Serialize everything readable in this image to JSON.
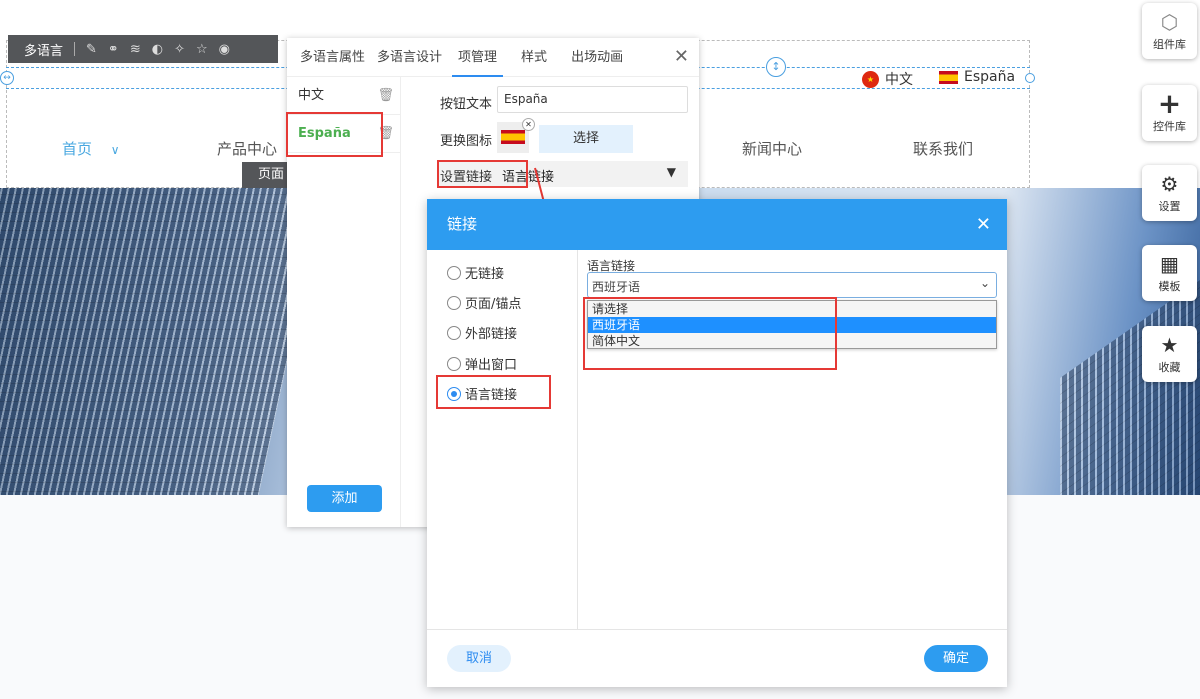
{
  "toolbar": {
    "label": "多语言",
    "icons": [
      "edit-icon",
      "link-icon",
      "layers-icon",
      "palette-icon",
      "magic-icon",
      "star-icon",
      "eye-icon"
    ]
  },
  "lang_switch": [
    {
      "label": "中文",
      "flag": "china-flag"
    },
    {
      "label": "España",
      "flag": "spain-flag"
    }
  ],
  "nav": [
    "首页",
    "产品中心",
    "新闻中心",
    "联系我们"
  ],
  "page_tab": "页面",
  "panel": {
    "tabs": [
      "多语言属性",
      "多语言设计",
      "项管理",
      "样式",
      "出场动画"
    ],
    "active_tab": "项管理",
    "items": [
      "中文",
      "España"
    ],
    "add_label": "添加",
    "form": {
      "text_label": "按钮文本",
      "text_value": "España",
      "icon_label": "更换图标",
      "choose_label": "选择",
      "link_label": "设置链接",
      "link_value": "语言链接"
    }
  },
  "dialog": {
    "title": "链接",
    "options": [
      "无链接",
      "页面/锚点",
      "外部链接",
      "弹出窗口",
      "语言链接"
    ],
    "selected": "语言链接",
    "field_label": "语言链接",
    "select_value": "西班牙语",
    "dropdown": [
      "请选择",
      "西班牙语",
      "简体中文"
    ],
    "cancel": "取消",
    "ok": "确定"
  },
  "sidebar": [
    "组件库",
    "控件库",
    "设置",
    "模板",
    "收藏"
  ],
  "colors": {
    "accent": "#2d9cf0",
    "highlight": "#e53935",
    "active_item": "#4caf50"
  }
}
